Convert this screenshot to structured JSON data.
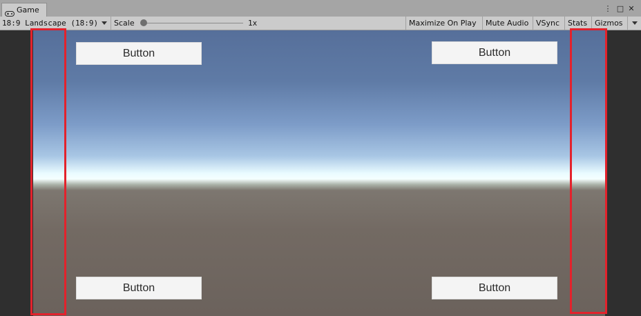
{
  "window": {
    "tab_title": "Game",
    "controls": {
      "more": "⋮",
      "maximize": "□",
      "close": "✕"
    }
  },
  "toolbar": {
    "aspect": "18:9 Landscape (18:9)",
    "scale_label": "Scale",
    "scale_value": "1x",
    "maximize_on_play": "Maximize On Play",
    "mute_audio": "Mute Audio",
    "vsync": "VSync",
    "stats": "Stats",
    "gizmos": "Gizmos"
  },
  "game": {
    "buttons": {
      "top_left": "Button",
      "top_right": "Button",
      "bottom_left": "Button",
      "bottom_right": "Button"
    },
    "highlight_color": "#e3222c"
  }
}
